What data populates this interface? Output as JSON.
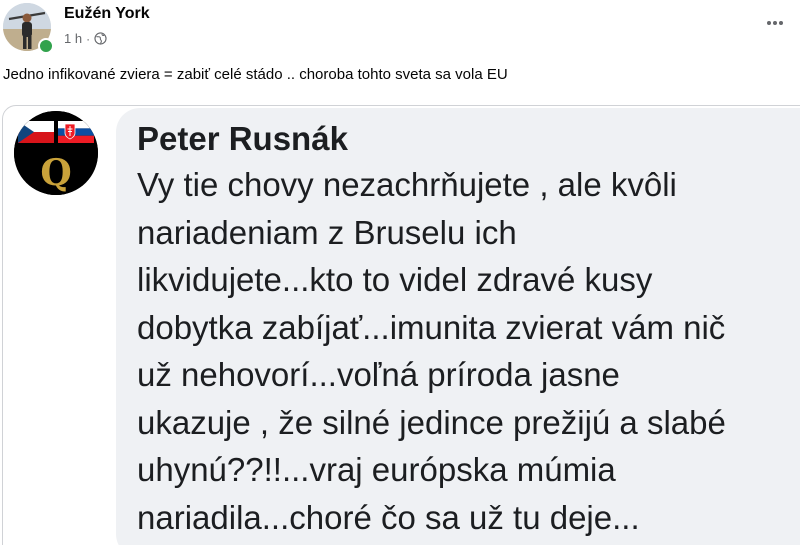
{
  "post": {
    "author": "Eužén York",
    "time": "1 h",
    "separator": "·",
    "privacy_icon": "globe-icon",
    "more_icon": "more-horizontal-icon",
    "text": "Jedno infikované zviera = zabiť celé stádo .. choroba tohto sveta sa vola EU"
  },
  "shared_comment": {
    "name": "Peter Rusnák",
    "avatar_letter": "Q",
    "lines": [
      "Vy tie chovy nezachrňujete , ale kvôli",
      "nariadeniam z Bruselu ich",
      "likvidujete...kto to videl zdravé kusy",
      "dobytka zabíjať...imunita zvierat vám nič",
      "už nehovorí...voľná príroda jasne",
      "ukazuje , že silné jedince prežijú a slabé",
      "uhynú??!!...vraj európska múmia",
      "nariadila...choré čo sa už tu deje..."
    ]
  },
  "colors": {
    "online": "#31a24c",
    "meta_text": "#65676b",
    "bubble": "#eff1f4",
    "gold": "#c9a23a"
  }
}
